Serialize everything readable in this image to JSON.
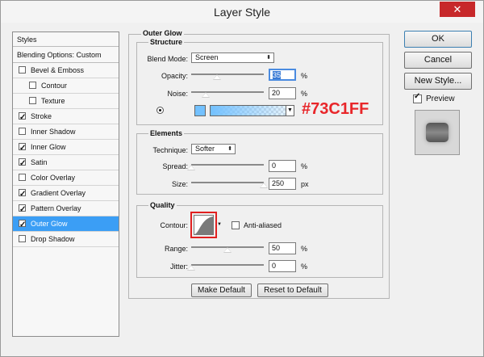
{
  "window": {
    "title": "Layer Style",
    "close": "✕"
  },
  "styles_panel": {
    "header": "Styles",
    "blending": "Blending Options: Custom",
    "items": [
      {
        "label": "Bevel & Emboss",
        "checked": false,
        "indent": false,
        "selected": false
      },
      {
        "label": "Contour",
        "checked": false,
        "indent": true,
        "selected": false
      },
      {
        "label": "Texture",
        "checked": false,
        "indent": true,
        "selected": false
      },
      {
        "label": "Stroke",
        "checked": true,
        "indent": false,
        "selected": false
      },
      {
        "label": "Inner Shadow",
        "checked": false,
        "indent": false,
        "selected": false
      },
      {
        "label": "Inner Glow",
        "checked": true,
        "indent": false,
        "selected": false
      },
      {
        "label": "Satin",
        "checked": true,
        "indent": false,
        "selected": false
      },
      {
        "label": "Color Overlay",
        "checked": false,
        "indent": false,
        "selected": false
      },
      {
        "label": "Gradient Overlay",
        "checked": true,
        "indent": false,
        "selected": false
      },
      {
        "label": "Pattern Overlay",
        "checked": true,
        "indent": false,
        "selected": false
      },
      {
        "label": "Outer Glow",
        "checked": true,
        "indent": false,
        "selected": true
      },
      {
        "label": "Drop Shadow",
        "checked": false,
        "indent": false,
        "selected": false
      }
    ]
  },
  "outer_glow": {
    "title": "Outer Glow",
    "structure": {
      "title": "Structure",
      "blend_mode_label": "Blend Mode:",
      "blend_mode_value": "Screen",
      "opacity_label": "Opacity:",
      "opacity_value": "35",
      "opacity_unit": "%",
      "opacity_level": 0.35,
      "noise_label": "Noise:",
      "noise_value": "20",
      "noise_unit": "%",
      "noise_level": 0.2,
      "glow_color": "#73C1FF"
    },
    "elements": {
      "title": "Elements",
      "technique_label": "Technique:",
      "technique_value": "Softer",
      "spread_label": "Spread:",
      "spread_value": "0",
      "spread_unit": "%",
      "spread_level": 0,
      "size_label": "Size:",
      "size_value": "250",
      "size_unit": "px",
      "size_level": 1.0
    },
    "quality": {
      "title": "Quality",
      "contour_label": "Contour:",
      "anti_aliased_label": "Anti-aliased",
      "range_label": "Range:",
      "range_value": "50",
      "range_unit": "%",
      "range_level": 0.5,
      "jitter_label": "Jitter:",
      "jitter_value": "0",
      "jitter_unit": "%",
      "jitter_level": 0
    },
    "make_default": "Make Default",
    "reset_default": "Reset to Default"
  },
  "annotation": {
    "text": "#73C1FF",
    "color": "#e8262a"
  },
  "actions": {
    "ok": "OK",
    "cancel": "Cancel",
    "new_style": "New Style...",
    "preview_label": "Preview",
    "preview_checked": true
  }
}
